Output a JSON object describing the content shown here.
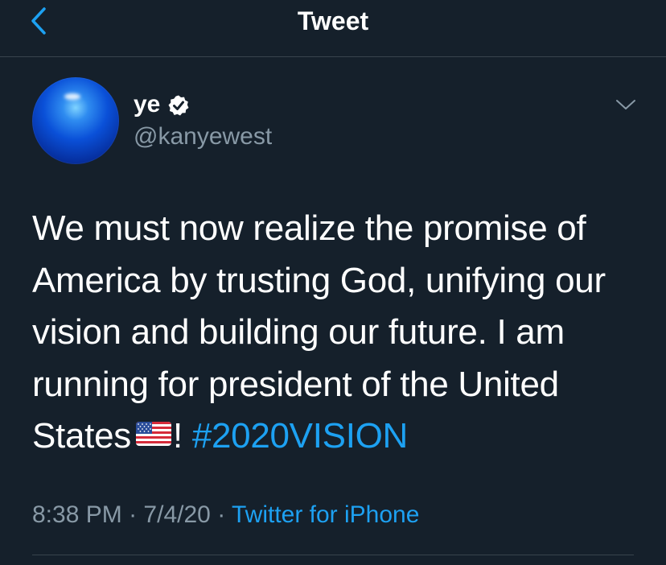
{
  "header": {
    "title": "Tweet",
    "back_icon": "chevron-left-icon"
  },
  "author": {
    "name": "ye",
    "handle": "@kanyewest",
    "verified": true,
    "more_icon": "chevron-down-icon"
  },
  "tweet": {
    "text_main": "We must now realize the promise of America by trusting God, unifying our vision and building our future. I am running for president of the United States",
    "flag_emoji": "us-flag-icon",
    "text_after_flag": "!",
    "hashtag": "#2020VISION"
  },
  "meta": {
    "time": "8:38 PM",
    "separator1": "·",
    "date": "7/4/20",
    "separator2": "·",
    "source": "Twitter for iPhone"
  },
  "colors": {
    "background": "#15202b",
    "accent": "#1da1f2",
    "secondary_text": "#8899a6",
    "divider": "#38444d"
  }
}
